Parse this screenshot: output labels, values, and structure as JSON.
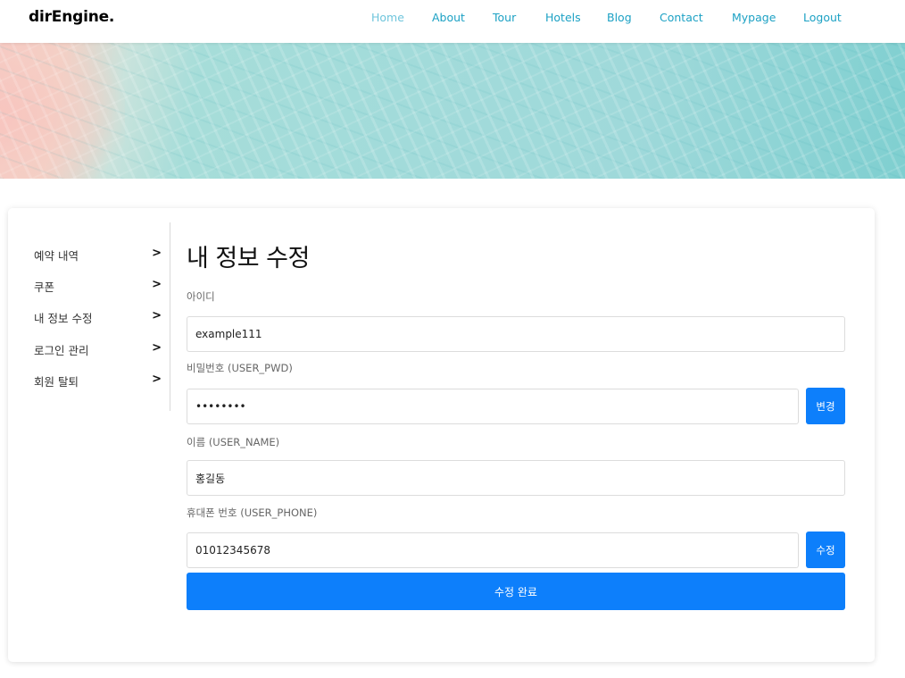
{
  "nav": {
    "brand": "dirEngine.",
    "links": [
      {
        "label": "Home"
      },
      {
        "label": "About"
      },
      {
        "label": "Tour"
      },
      {
        "label": "Hotels"
      },
      {
        "label": "Blog"
      },
      {
        "label": "Contact"
      },
      {
        "label": "Mypage"
      },
      {
        "label": "Logout"
      }
    ]
  },
  "sidebar": {
    "items": [
      {
        "label": "예약 내역",
        "chevron": ">"
      },
      {
        "label": "쿠폰",
        "chevron": ">"
      },
      {
        "label": "내 정보 수정",
        "chevron": ">"
      },
      {
        "label": "로그인 관리",
        "chevron": ">"
      },
      {
        "label": "회원 탈퇴",
        "chevron": ">"
      }
    ]
  },
  "form": {
    "title": "내 정보 수정",
    "id": {
      "label": "아이디",
      "value": "example111"
    },
    "password": {
      "label": "비밀번호 (USER_PWD)",
      "value": "password",
      "button": "변경"
    },
    "name": {
      "label": "이름 (USER_NAME)",
      "value": "홍길동"
    },
    "phone": {
      "label": "휴대폰 번호 (USER_PHONE)",
      "value": "01012345678",
      "button": "수정"
    },
    "submit": "수정 완료"
  },
  "colors": {
    "nav_link": "#1ca1c4",
    "nav_active": "#6fc5dc",
    "primary_button": "#0d7ffb"
  }
}
